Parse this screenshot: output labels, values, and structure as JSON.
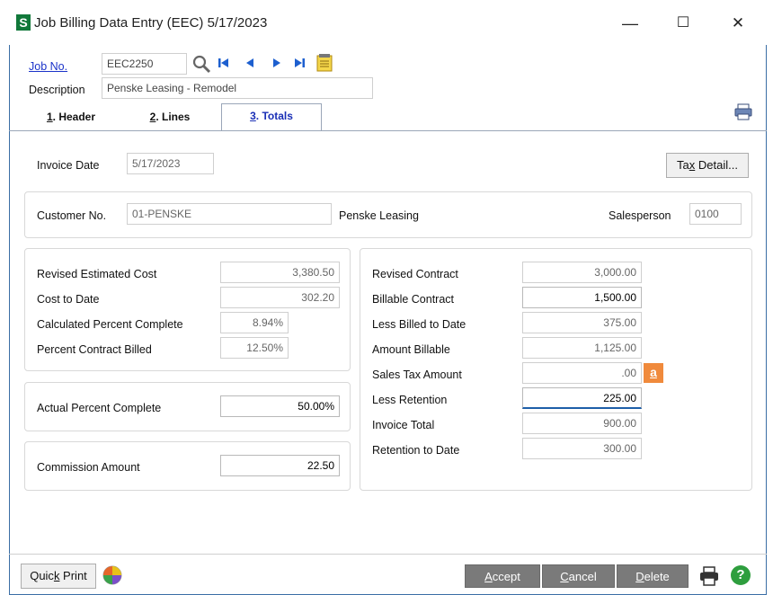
{
  "window": {
    "logo": "S",
    "title": "Job Billing Data Entry (EEC) 5/17/2023",
    "minimize": "—",
    "maximize": "☐",
    "close": "✕"
  },
  "job": {
    "label": "Job No.",
    "value": "EEC2250",
    "description_label": "Description",
    "description_value": "Penske Leasing - Remodel"
  },
  "tabs": [
    {
      "num": "1",
      "label": ". Header"
    },
    {
      "num": "2",
      "label": ". Lines"
    },
    {
      "num": "3",
      "label": ". Totals"
    }
  ],
  "invoice": {
    "label": "Invoice Date",
    "value": "5/17/2023",
    "tax_detail_pre": "Ta",
    "tax_detail_u": "x",
    "tax_detail_post": " Detail..."
  },
  "customer": {
    "label": "Customer No.",
    "value": "01-PENSKE",
    "name": "Penske Leasing",
    "salesperson_label": "Salesperson",
    "salesperson_value": "0100"
  },
  "left": {
    "revised_est_cost_label": "Revised Estimated Cost",
    "revised_est_cost": "3,380.50",
    "cost_to_date_label": "Cost to Date",
    "cost_to_date": "302.20",
    "calc_pct_label": "Calculated Percent Complete",
    "calc_pct": "8.94%",
    "pct_billed_label": "Percent Contract Billed",
    "pct_billed": "12.50%",
    "actual_pct_label": "Actual Percent Complete",
    "actual_pct": "50.00%",
    "commission_label": "Commission Amount",
    "commission": "22.50"
  },
  "right": {
    "revised_contract_label": "Revised Contract",
    "revised_contract": "3,000.00",
    "billable_contract_label": "Billable Contract",
    "billable_contract": "1,500.00",
    "less_billed_label": "Less Billed to Date",
    "less_billed": "375.00",
    "amount_billable_label": "Amount Billable",
    "amount_billable": "1,125.00",
    "sales_tax_label": "Sales Tax Amount",
    "sales_tax": ".00",
    "less_retention_label": "Less Retention",
    "less_retention": "225.00",
    "invoice_total_label": "Invoice Total",
    "invoice_total": "900.00",
    "retention_to_date_label": "Retention to Date",
    "retention_to_date": "300.00",
    "tax_badge": "a"
  },
  "footer": {
    "quick_print_pre": "Quic",
    "quick_print_u": "k",
    "quick_print_post": " Print",
    "accept_u": "A",
    "accept_post": "ccept",
    "cancel_u": "C",
    "cancel_post": "ancel",
    "delete_u": "D",
    "delete_post": "elete",
    "help": "?"
  },
  "colors": {
    "accent_blue": "#1b33c9",
    "logo_green": "#11783a",
    "button_gray": "#7a7a7a",
    "badge_orange": "#f08a3c"
  }
}
